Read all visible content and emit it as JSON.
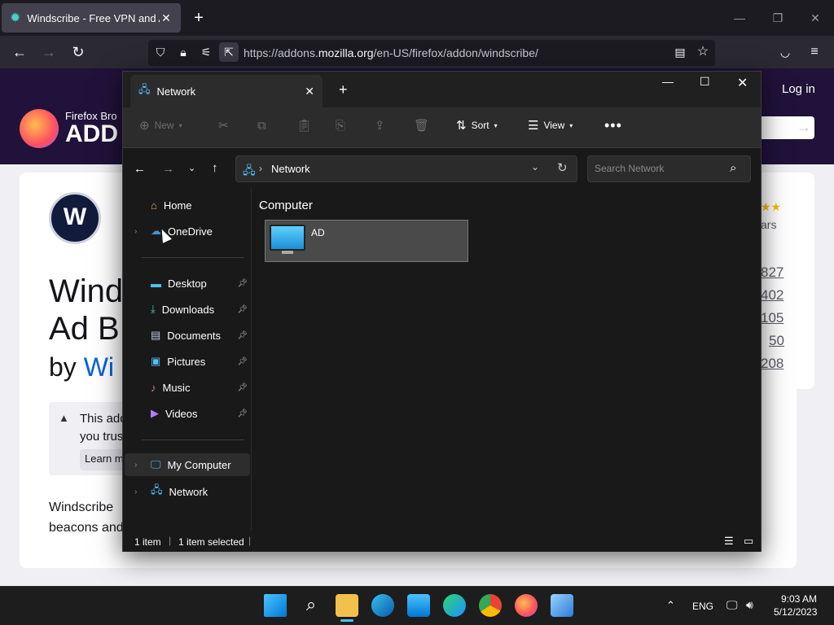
{
  "firefox": {
    "tab_title": "Windscribe - Free VPN and Ad B",
    "url_prefix": "https://addons.",
    "url_domain": "mozilla.org",
    "url_suffix": "/en-US/firefox/addon/windscribe/"
  },
  "amo": {
    "logo_line1": "Firefox Bro",
    "logo_line2": "ADD",
    "login": "Log in",
    "addon_title_line1": "Wind",
    "addon_title_line2": "Ad B",
    "by_text": "by ",
    "by_link": "Wi",
    "warning_line1": "This add",
    "warning_line2": "you trus",
    "learn_more": "Learn m",
    "desc_line1": "Windscribe",
    "desc_line2": "beacons and",
    "rating_text": "ars",
    "stats": [
      "827",
      "402",
      "105",
      "50",
      "208"
    ]
  },
  "explorer": {
    "tab_title": "Network",
    "toolbar": {
      "new": "New",
      "sort": "Sort",
      "view": "View"
    },
    "address": "Network",
    "search_placeholder": "Search Network",
    "nav": {
      "home": "Home",
      "onedrive": "OneDrive",
      "desktop": "Desktop",
      "downloads": "Downloads",
      "documents": "Documents",
      "pictures": "Pictures",
      "music": "Music",
      "videos": "Videos",
      "my_computer": "My Computer",
      "network": "Network"
    },
    "group_header": "Computer",
    "items": [
      {
        "label": "AD"
      }
    ],
    "status": {
      "count": "1 item",
      "selected": "1 item selected"
    }
  },
  "taskbar": {
    "lang": "ENG",
    "time": "9:03 AM",
    "date": "5/12/2023"
  }
}
